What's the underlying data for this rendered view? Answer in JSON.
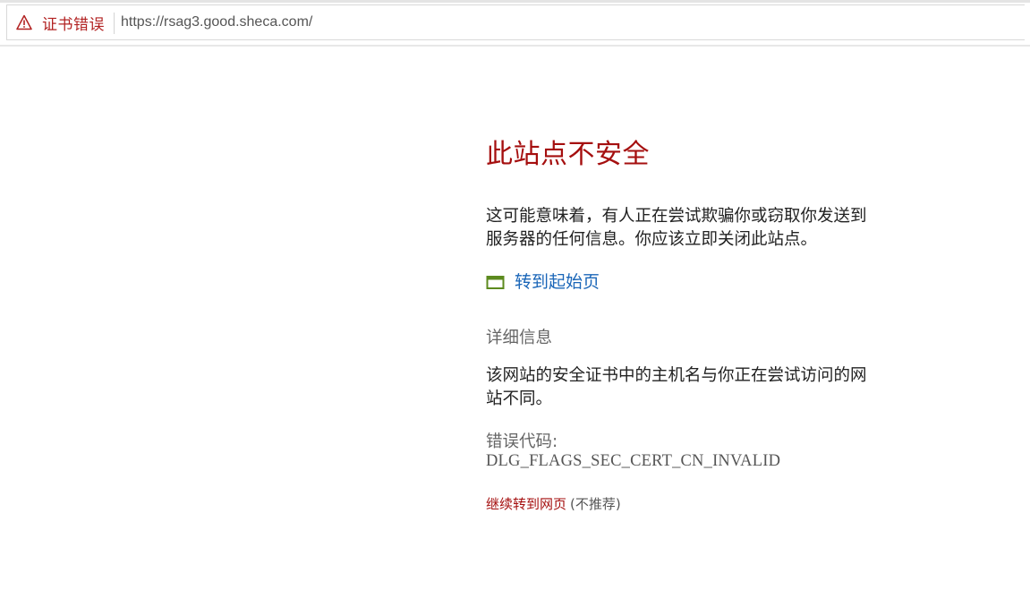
{
  "address_bar": {
    "cert_error_label": "证书错误",
    "cert_error_icon": "warning-triangle-icon",
    "url": "https://rsag3.good.sheca.com/"
  },
  "page": {
    "title": "此站点不安全",
    "description": "这可能意味着，有人正在尝试欺骗你或窃取你发送到服务器的任何信息。你应该立即关闭此站点。",
    "start_page_icon": "window-icon",
    "start_page_link": "转到起始页",
    "details_heading": "详细信息",
    "details_body": "该网站的安全证书中的主机名与你正在尝试访问的网站不同。",
    "error_code_label": "错误代码:",
    "error_code": "DLG_FLAGS_SEC_CERT_CN_INVALID",
    "continue_link": "继续转到网页",
    "not_recommended": "(不推荐)"
  },
  "colors": {
    "title_red": "#a50f0f",
    "link_blue": "#1a66b8",
    "icon_green": "#5c8a1e",
    "warning_red": "#b22222"
  }
}
